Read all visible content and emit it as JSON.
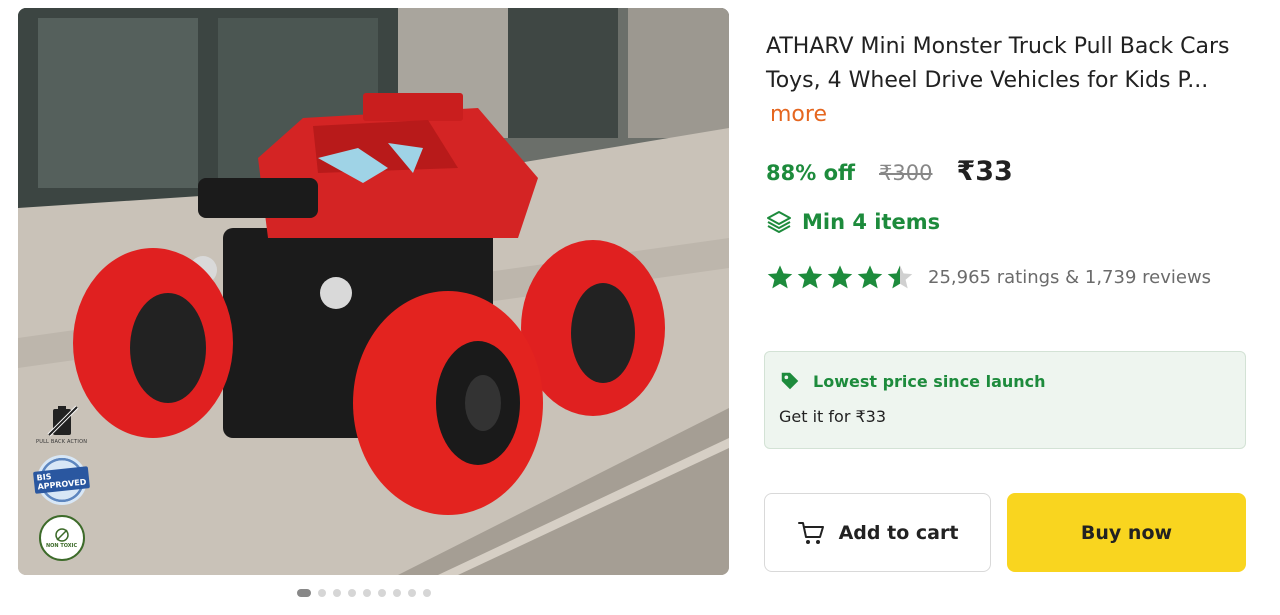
{
  "product": {
    "title": "ATHARV Mini Monster Truck Pull Back Cars Toys, 4 Wheel Drive Vehicles for Kids P...",
    "more_label": "more",
    "image_alt": "Red mini monster truck toy on a sidewalk"
  },
  "badges": {
    "pull_back": "PULL BACK ACTION",
    "bis": "BIS APPROVED",
    "non_toxic": "NON TOXIC"
  },
  "gallery": {
    "total_images": 9,
    "active_index": 0
  },
  "pricing": {
    "discount": "88% off",
    "mrp": "₹300",
    "price": "₹33"
  },
  "min_order": {
    "label": "Min 4 items",
    "icon": "layers-icon"
  },
  "rating": {
    "value": 4.5,
    "text": "25,965 ratings & 1,739 reviews",
    "star_color": "#1d8b3c"
  },
  "offer": {
    "headline": "Lowest price since launch",
    "detail": "Get it for ₹33",
    "icon": "tag-icon"
  },
  "actions": {
    "add_to_cart": "Add to cart",
    "buy_now": "Buy now"
  },
  "colors": {
    "accent_green": "#1d8b3c",
    "more_orange": "#e5661f",
    "buy_yellow": "#f9d51f"
  }
}
